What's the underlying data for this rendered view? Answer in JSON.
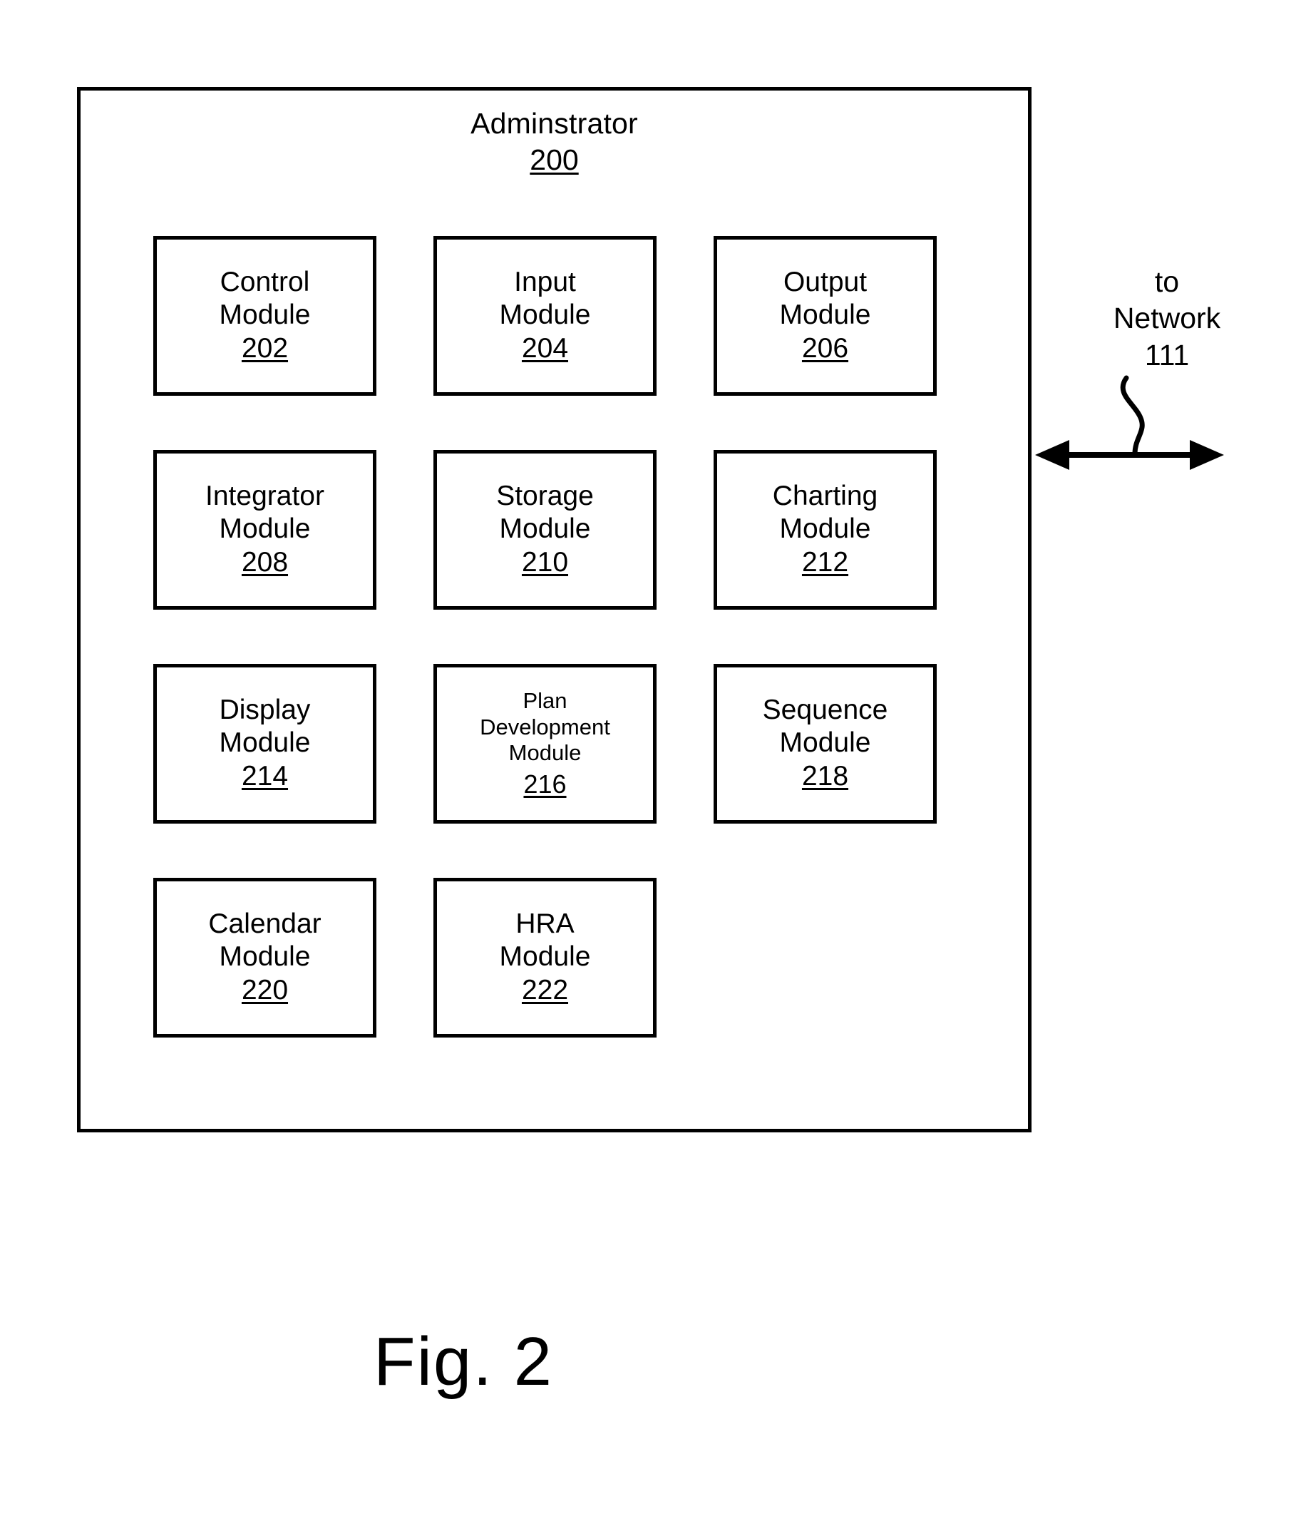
{
  "figure": {
    "caption": "Fig. 2"
  },
  "container": {
    "title": "Adminstrator",
    "ref": "200"
  },
  "network": {
    "line1": "to",
    "line2": "Network",
    "line3": "111",
    "arrow_icon": "double-headed-arrow-icon",
    "leader_icon": "squiggle-leader-icon"
  },
  "modules": {
    "rows": [
      [
        {
          "lines": [
            "Control",
            "Module"
          ],
          "ref": "202",
          "slot": "control-module"
        },
        {
          "lines": [
            "Input",
            "Module"
          ],
          "ref": "204",
          "slot": "input-module"
        },
        {
          "lines": [
            "Output",
            "Module"
          ],
          "ref": "206",
          "slot": "output-module"
        }
      ],
      [
        {
          "lines": [
            "Integrator",
            "Module"
          ],
          "ref": "208",
          "slot": "integrator-module"
        },
        {
          "lines": [
            "Storage",
            "Module"
          ],
          "ref": "210",
          "slot": "storage-module"
        },
        {
          "lines": [
            "Charting",
            "Module"
          ],
          "ref": "212",
          "slot": "charting-module"
        }
      ],
      [
        {
          "lines": [
            "Display",
            "Module"
          ],
          "ref": "214",
          "slot": "display-module"
        },
        {
          "lines": [
            "Plan",
            "Development",
            "Module"
          ],
          "ref": "216",
          "slot": "plan-development-module"
        },
        {
          "lines": [
            "Sequence",
            "Module"
          ],
          "ref": "218",
          "slot": "sequence-module"
        }
      ],
      [
        {
          "lines": [
            "Calendar",
            "Module"
          ],
          "ref": "220",
          "slot": "calendar-module"
        },
        {
          "lines": [
            "HRA",
            "Module"
          ],
          "ref": "222",
          "slot": "hra-module"
        },
        {
          "lines": [],
          "ref": "",
          "slot": "empty-slot"
        }
      ]
    ]
  }
}
